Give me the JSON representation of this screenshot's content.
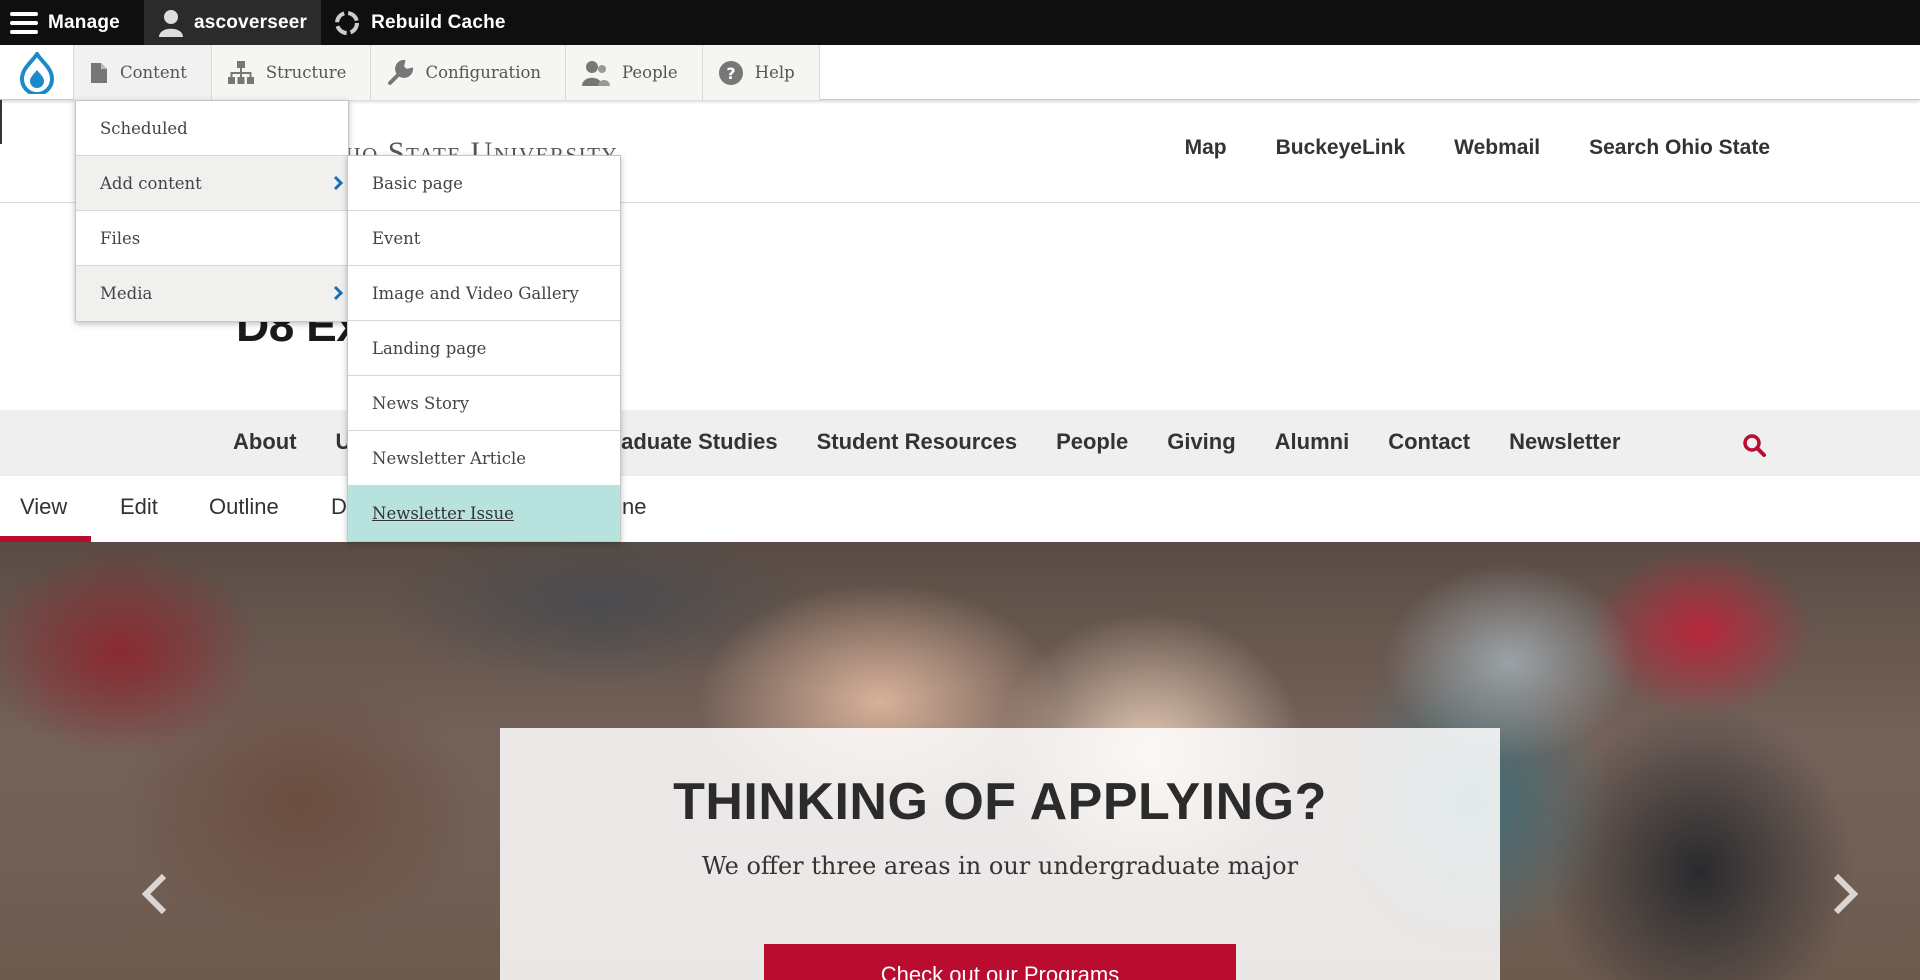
{
  "admin_bar": {
    "manage_label": "Manage",
    "user_label": "ascoverseer",
    "rebuild_label": "Rebuild Cache"
  },
  "admin_tray": {
    "items": [
      {
        "label": "Content",
        "icon": "file-icon"
      },
      {
        "label": "Structure",
        "icon": "sitemap-icon"
      },
      {
        "label": "Configuration",
        "icon": "wrench-icon"
      },
      {
        "label": "People",
        "icon": "people-icon"
      },
      {
        "label": "Help",
        "icon": "help-icon"
      }
    ]
  },
  "content_menu": {
    "items": [
      {
        "label": "Scheduled",
        "submenu": false
      },
      {
        "label": "Add content",
        "submenu": true
      },
      {
        "label": "Files",
        "submenu": false
      },
      {
        "label": "Media",
        "submenu": true
      }
    ]
  },
  "add_content_menu": {
    "items": [
      {
        "label": "Basic page"
      },
      {
        "label": "Event"
      },
      {
        "label": "Image and Video Gallery"
      },
      {
        "label": "Landing page"
      },
      {
        "label": "News Story"
      },
      {
        "label": "Newsletter Article"
      },
      {
        "label": "Newsletter Issue",
        "highlighted": true
      }
    ]
  },
  "site_header": {
    "wordmark_visible": "hio State University",
    "links": [
      "Map",
      "BuckeyeLink",
      "Webmail",
      "Search Ohio State"
    ]
  },
  "site_title_visible": "D8 Ex",
  "main_nav": {
    "items": [
      "About",
      "U",
      "raduate Studies",
      "Student Resources",
      "People",
      "Giving",
      "Alumni",
      "Contact",
      "Newsletter"
    ]
  },
  "local_tabs": {
    "items": [
      "View",
      "Edit",
      "Outline",
      "D",
      "ne"
    ],
    "active": "View"
  },
  "hero": {
    "title": "THINKING OF APPLYING?",
    "subtitle": "We offer three areas in our undergraduate major",
    "button_label": "Check out our Programs"
  },
  "colors": {
    "brand_scarlet": "#ba0c2f",
    "highlight": "#b7e2dd",
    "drupal_blue": "#1a8ac9"
  }
}
